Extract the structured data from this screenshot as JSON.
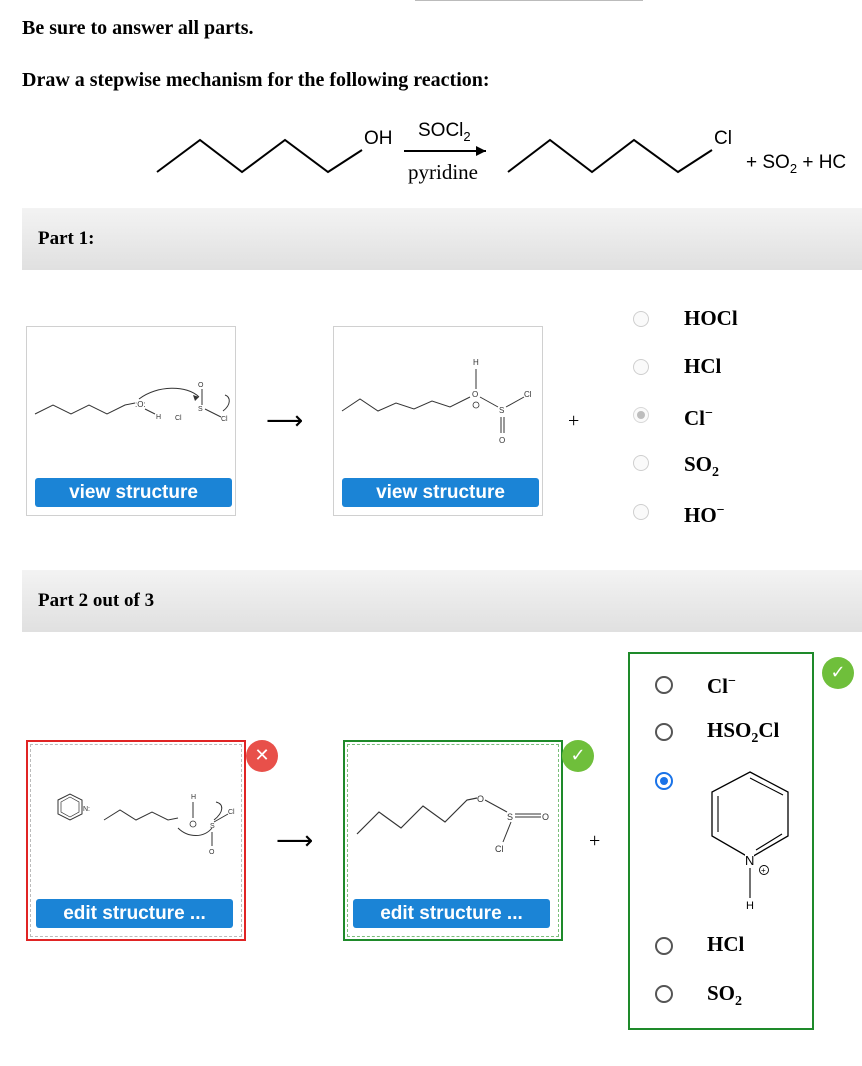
{
  "instructions": {
    "line1": "Be sure to answer all parts.",
    "line2": "Draw a stepwise mechanism for the following reaction:"
  },
  "reaction": {
    "reactant_group": "OH",
    "reagent_top": "SOCl",
    "reagent_top_sub": "2",
    "reagent_bottom": "pyridine",
    "product_group": "Cl",
    "byproducts_prefix": "+ SO",
    "byproducts_sub": "2",
    "byproducts_suffix": " + HC"
  },
  "part1": {
    "label": "Part 1:",
    "box1_button": "view structure",
    "box2_button": "view structure",
    "box1_labels": {
      "o": ":O:",
      "h": "H",
      "cl": "Cl",
      "s": "S",
      "o2": "O",
      "cl2": "Cl"
    },
    "box2_labels": {
      "h": "H",
      "o": "O",
      "s": "S",
      "cl": "Cl",
      "o2": "O"
    },
    "arrow": "⟶",
    "plus": "+",
    "options": [
      {
        "main": "HOCl",
        "sub": "",
        "sup": ""
      },
      {
        "main": "HCl",
        "sub": "",
        "sup": ""
      },
      {
        "main": "Cl",
        "sub": "",
        "sup": "−"
      },
      {
        "main": "SO",
        "sub": "2",
        "sup": ""
      },
      {
        "main": "HO",
        "sub": "",
        "sup": "−"
      }
    ],
    "selected_index": 2
  },
  "part2": {
    "label": "Part 2 out of 3",
    "box1_button": "edit structure ...",
    "box2_button": "edit structure ...",
    "box1_labels": {
      "n": "N:",
      "h": "H",
      "s": "S",
      "cl": "Cl",
      "o": "O"
    },
    "box2_labels": {
      "o": "O",
      "s": "S",
      "o2": "O",
      "cl": "Cl"
    },
    "arrow": "⟶",
    "plus": "+",
    "wrong_mark": "✕",
    "correct_mark": "✓",
    "options": [
      {
        "main": "Cl",
        "sub": "",
        "sup": "−"
      },
      {
        "main": "HSO",
        "sub": "2",
        "suffix": "Cl"
      },
      {
        "structure": "pyridinium",
        "n_label": "N",
        "h_label": "H"
      },
      {
        "main": "HCl",
        "sub": "",
        "sup": ""
      },
      {
        "main": "SO",
        "sub": "2",
        "sup": ""
      }
    ],
    "selected_index": 2
  },
  "colors": {
    "button": "#1b84d6",
    "incorrect": "#e02424",
    "correct": "#1e8a2a",
    "badge_correct": "#6fbf3b",
    "badge_incorrect": "#e8504a",
    "radio_selected": "#1a73e8"
  }
}
